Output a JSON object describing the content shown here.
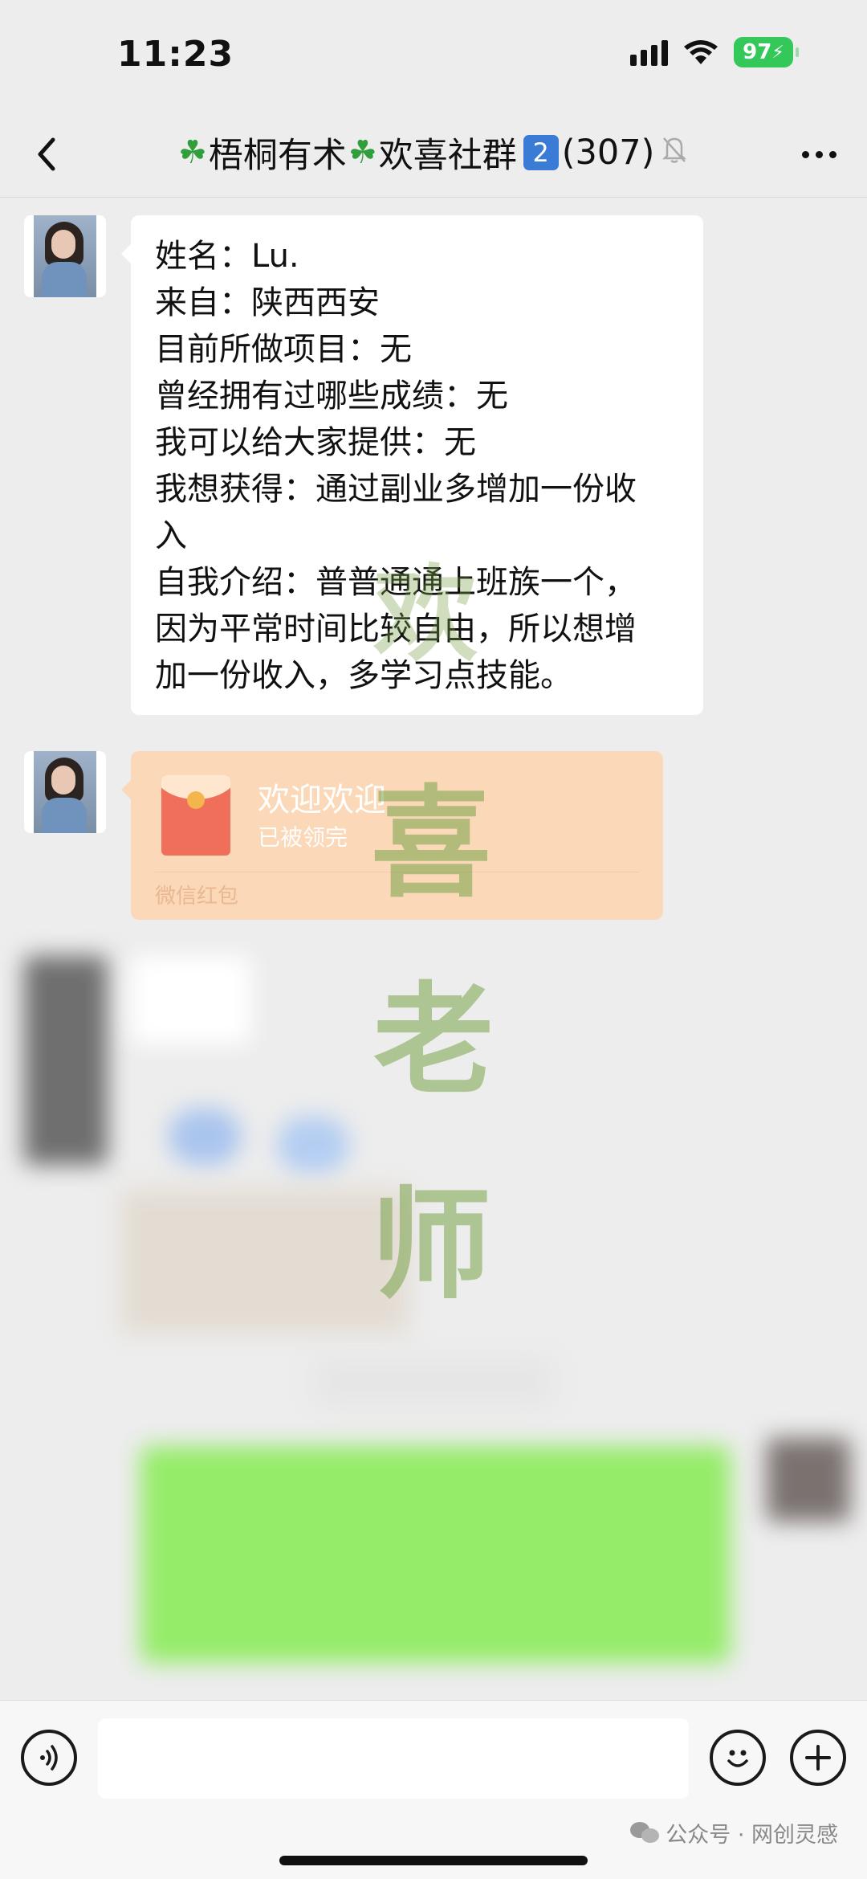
{
  "status_bar": {
    "time": "11:23",
    "battery": "97"
  },
  "nav": {
    "title_part1": "梧桐有术",
    "title_part2": "欢喜社群",
    "badge": "2",
    "member_count": "(307)"
  },
  "messages": [
    {
      "type": "text",
      "lines": [
        "姓名：Lu.",
        "来自：陕西西安",
        "目前所做项目：无",
        "曾经拥有过哪些成绩：无",
        "我可以给大家提供：无",
        "我想获得：通过副业多增加一份收",
        "入",
        "自我介绍：普普通通上班族一个，",
        "因为平常时间比较自由，所以想增",
        "加一份收入，多学习点技能。"
      ]
    },
    {
      "type": "red_packet",
      "title": "欢迎欢迎",
      "subtitle": "已被领完",
      "footer": "微信红包"
    }
  ],
  "watermark": [
    "欢",
    "喜",
    "老",
    "师"
  ],
  "input_bar": {
    "placeholder": ""
  },
  "footer_credit": "公众号 · 网创灵感",
  "colors": {
    "background": "#ededed",
    "bubble": "#ffffff",
    "red_packet": "#fbd9b8",
    "own_bubble": "#95ec69",
    "battery": "#34c759",
    "badge": "#3a7bd5"
  },
  "icons": [
    "back-icon",
    "clover-icon",
    "mute-bell-icon",
    "more-icon",
    "voice-icon",
    "emoji-icon",
    "plus-icon",
    "red-packet-icon",
    "wechat-logo-icon"
  ]
}
